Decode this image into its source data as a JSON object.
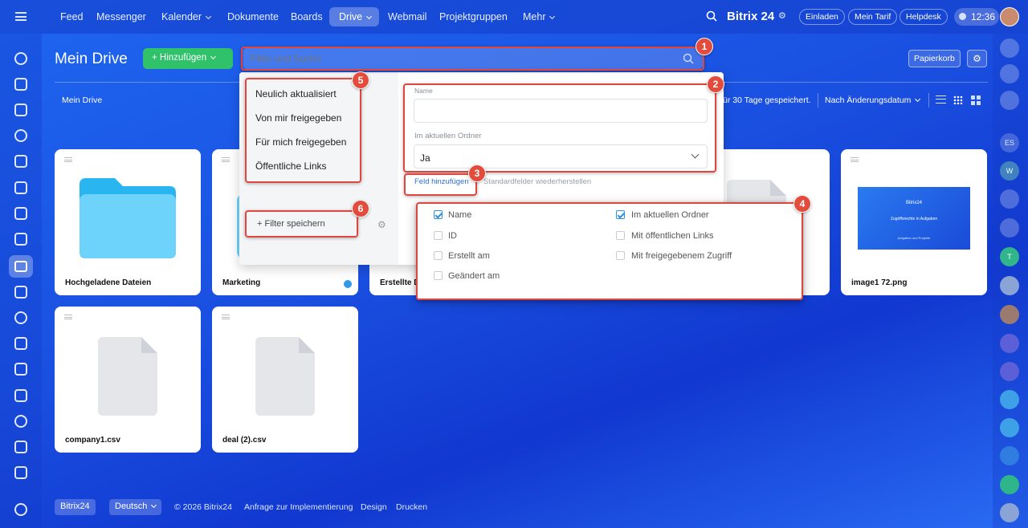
{
  "topnav": {
    "items": [
      "Feed",
      "Messenger",
      "Kalender",
      "Dokumente",
      "Boards",
      "Drive",
      "Webmail",
      "Projektgruppen",
      "Mehr"
    ],
    "brand": "Bitrix 24",
    "invite": "Einladen",
    "tariff": "Mein Tarif",
    "helpdesk": "Helpdesk",
    "time": "12:36"
  },
  "page": {
    "title": "Mein Drive",
    "add_button": "Hinzufügen",
    "search_placeholder": "Filter und Suche",
    "trash_button": "Papierkorb",
    "breadcrumb": "Mein Drive",
    "retention_note": "ür 30 Tage gespeichert.",
    "sort_label": "Nach Änderungsdatum"
  },
  "filter": {
    "presets": [
      "Neulich aktualisiert",
      "Von mir freigegeben",
      "Für mich freigegeben",
      "Öffentliche Links"
    ],
    "save_filter": "Filter speichern",
    "name_label": "Name",
    "folder_label": "Im aktuellen Ordner",
    "folder_value": "Ja",
    "add_field": "Feld hinzufügen",
    "restore_fields": "Standardfelder wiederherstellen"
  },
  "field_options": [
    {
      "label": "Name",
      "checked": true
    },
    {
      "label": "Im aktuellen Ordner",
      "checked": true
    },
    {
      "label": "ID",
      "checked": false
    },
    {
      "label": "Mit öffentlichen Links",
      "checked": false
    },
    {
      "label": "Erstellt am",
      "checked": false
    },
    {
      "label": "Mit freigegebenem Zugriff",
      "checked": false
    },
    {
      "label": "Geändert am",
      "checked": false
    }
  ],
  "files": [
    {
      "name": "Hochgeladene Dateien",
      "type": "folder"
    },
    {
      "name": "Marketing",
      "type": "folder"
    },
    {
      "name": "Erstellte Dateien",
      "type": "folder"
    },
    {
      "name": "image1 72.png",
      "type": "image"
    },
    {
      "name": "company1.csv",
      "type": "file"
    },
    {
      "name": "deal (2).csv",
      "type": "file"
    }
  ],
  "image_preview": {
    "line1": "Bitrix24",
    "line2": "Zugriffsrechte in Aufgaben",
    "line3": "Aufgaben und Projekte"
  },
  "annotations": [
    "1",
    "2",
    "3",
    "4",
    "5",
    "6"
  ],
  "footer": {
    "brand": "Bitrix24",
    "language": "Deutsch",
    "copyright": "© 2026 Bitrix24",
    "links": [
      "Anfrage zur Implementierung",
      "Design",
      "Drucken"
    ]
  },
  "right_avatars": [
    "ES",
    "W",
    "T"
  ],
  "colors": {
    "accent": "#2fc26b",
    "annotation": "#e34c3d",
    "link": "#2f6fd8"
  }
}
